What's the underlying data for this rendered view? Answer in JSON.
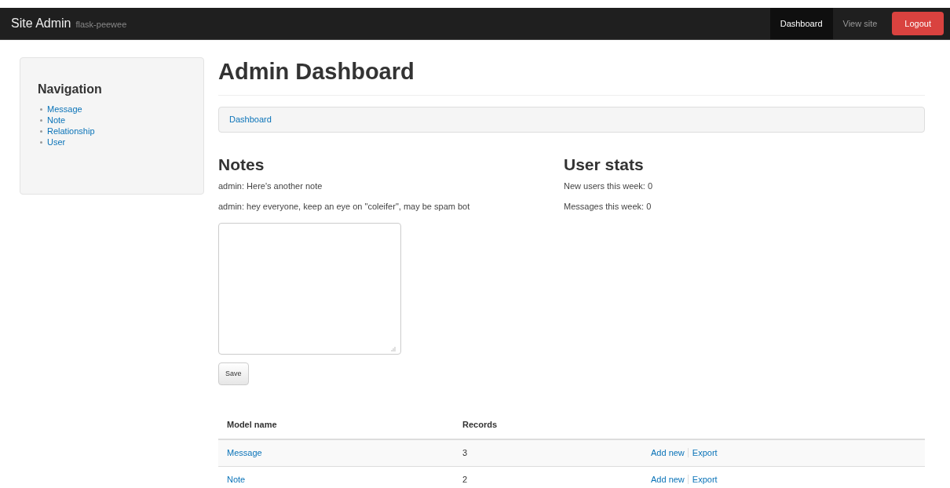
{
  "navbar": {
    "brand": "Site Admin",
    "subtitle": "flask-peewee",
    "links": [
      {
        "label": "Dashboard",
        "selected": true,
        "kind": "link"
      },
      {
        "label": "View site",
        "selected": false,
        "kind": "link"
      },
      {
        "label": "Logout",
        "selected": false,
        "kind": "danger"
      }
    ]
  },
  "sidebar": {
    "title": "Navigation",
    "items": [
      "Message",
      "Note",
      "Relationship",
      "User"
    ]
  },
  "title": "Admin Dashboard",
  "breadcrumb": [
    "Dashboard"
  ],
  "notes": {
    "title": "Notes",
    "items": [
      "admin: Here's another note",
      "admin: hey everyone, keep an eye on \"coleifer\", may be spam bot"
    ],
    "button": "Save"
  },
  "user_stats": {
    "title": "User stats",
    "items": [
      "New users this week: 0",
      "Messages this week: 0"
    ]
  },
  "table": {
    "columns": [
      "Model name",
      "Records"
    ],
    "rows": [
      {
        "name": "Message",
        "records": "3",
        "actions": [
          "Add new",
          "Export"
        ]
      },
      {
        "name": "Note",
        "records": "2",
        "actions": [
          "Add new",
          "Export"
        ]
      }
    ]
  }
}
